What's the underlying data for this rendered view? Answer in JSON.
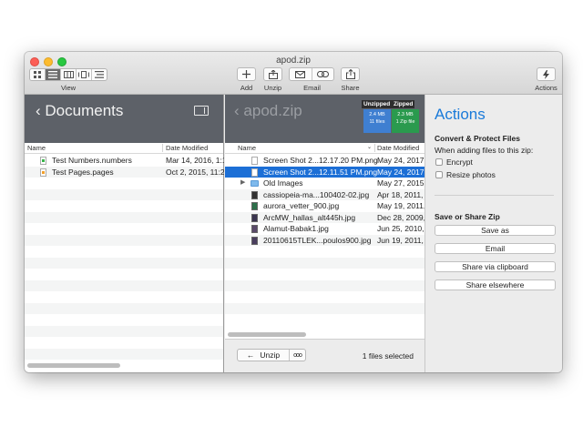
{
  "window": {
    "title": "apod.zip"
  },
  "toolbar": {
    "view_label": "View",
    "add_label": "Add",
    "unzip_label": "Unzip",
    "email_label": "Email",
    "share_label": "Share",
    "actions_label": "Actions"
  },
  "left_pane": {
    "title": "Documents",
    "columns": {
      "name": "Name",
      "date": "Date Modified"
    },
    "files": [
      {
        "name": "Test Numbers.numbers",
        "date": "Mar 14, 2016, 1:1"
      },
      {
        "name": "Test Pages.pages",
        "date": "Oct 2, 2015, 11:2"
      }
    ]
  },
  "archive_pane": {
    "title": "apod.zip",
    "unzipped_badge": "Unzipped",
    "zipped_badge": "Zipped",
    "unzipped_size": "2.4 MB",
    "unzipped_count": "11 files",
    "zipped_size": "2.3 MB",
    "zipped_count": "1 Zip file",
    "columns": {
      "name": "Name",
      "date": "Date Modified"
    },
    "files": [
      {
        "name": "Screen Shot 2...12.17.20 PM.png",
        "date": "May 24, 2017,"
      },
      {
        "name": "Screen Shot 2...12.11.51 PM.png",
        "date": "May 24, 2017,"
      },
      {
        "name": "Old Images",
        "date": "May 27, 2015,"
      },
      {
        "name": "cassiopeia-ma...100402-02.jpg",
        "date": "Apr 18, 2011, 1"
      },
      {
        "name": "aurora_vetter_900.jpg",
        "date": "May 19, 2011, 1"
      },
      {
        "name": "ArcMW_hallas_alt445h.jpg",
        "date": "Dec 28, 2009,"
      },
      {
        "name": "Alamut-Babak1.jpg",
        "date": "Jun 25, 2010,"
      },
      {
        "name": "20110615TLEK...poulos900.jpg",
        "date": "Jun 19, 2011, 1"
      }
    ],
    "unzip_button": "Unzip",
    "more_button": "ooo",
    "selection_status": "1 files selected"
  },
  "actions_pane": {
    "title": "Actions",
    "convert_heading": "Convert & Protect Files",
    "convert_subtext": "When adding files to this zip:",
    "encrypt_label": "Encrypt",
    "resize_label": "Resize photos",
    "share_heading": "Save or Share Zip",
    "save_as": "Save as",
    "email": "Email",
    "share_clipboard": "Share via clipboard",
    "share_elsewhere": "Share elsewhere"
  },
  "colors": {
    "accent": "#1a7ad9",
    "selection": "#1c6fd6",
    "header_dark": "#5d6168"
  }
}
